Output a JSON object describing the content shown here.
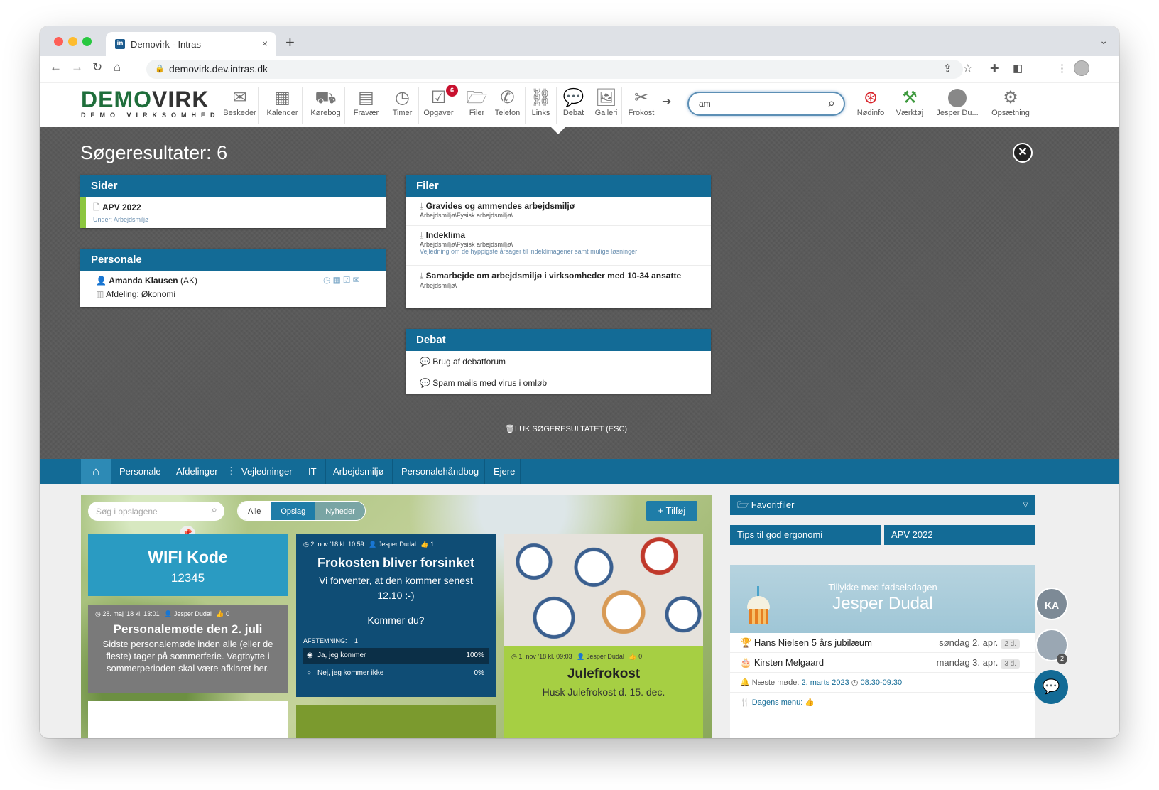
{
  "browser": {
    "tab_title": "Demovirk - Intras",
    "tab_favicon": "in",
    "url": "demovirk.dev.intras.dk",
    "new_tab": "+",
    "close_tab": "×"
  },
  "header": {
    "logo_main_a": "DEMO",
    "logo_main_b": "VIRK",
    "logo_sub": "DEMO VIRKSOMHED",
    "tools": [
      {
        "label": "Beskeder",
        "icon": "envelope-icon"
      },
      {
        "label": "Kalender",
        "icon": "calendar-icon"
      },
      {
        "label": "Kørebog",
        "icon": "car-icon"
      },
      {
        "label": "Fravær",
        "icon": "calendar-check-icon"
      },
      {
        "label": "Timer",
        "icon": "clock-icon"
      },
      {
        "label": "Opgaver",
        "icon": "checkbox-icon",
        "badge": "6"
      },
      {
        "label": "Filer",
        "icon": "folder-icon"
      },
      {
        "label": "Telefon",
        "icon": "phone-icon"
      },
      {
        "label": "Links",
        "icon": "link-icon"
      },
      {
        "label": "Debat",
        "icon": "chat-icon"
      },
      {
        "label": "Galleri",
        "icon": "gallery-icon"
      },
      {
        "label": "Frokost",
        "icon": "cutlery-icon"
      }
    ],
    "search_value": "am",
    "right_tools": [
      {
        "label": "Nødinfo",
        "icon": "lifebuoy-icon"
      },
      {
        "label": "Værktøj",
        "icon": "tools-icon"
      },
      {
        "label": "Jesper Du...",
        "icon": "user-avatar"
      },
      {
        "label": "Opsætning",
        "icon": "settings-icon"
      }
    ]
  },
  "results": {
    "title": "Søgeresultater: 6",
    "sider": {
      "heading": "Sider",
      "items": [
        {
          "title": "APV 2022",
          "sub": "Under: Arbejdsmiljø"
        }
      ]
    },
    "personale": {
      "heading": "Personale",
      "name": "Amanda Klausen",
      "initials": "(AK)",
      "dept": "Afdeling: Økonomi"
    },
    "filer": {
      "heading": "Filer",
      "items": [
        {
          "title": "Gravides og ammendes arbejdsmiljø",
          "path": "Arbejdsmiljø\\Fysisk arbejdsmiljø\\",
          "desc": ""
        },
        {
          "title": "Indeklima",
          "path": "Arbejdsmiljø\\Fysisk arbejdsmiljø\\",
          "desc": "Vejledning om de hyppigste årsager til indeklimagener samt mulige løsninger"
        },
        {
          "title": "Samarbejde om arbejdsmiljø i virksomheder med 10-34 ansatte",
          "path": "Arbejdsmiljø\\",
          "desc": ""
        }
      ]
    },
    "debat": {
      "heading": "Debat",
      "items": [
        {
          "title": "Brug af debatforum"
        },
        {
          "title": "Spam mails med virus i omløb"
        }
      ]
    },
    "close_label": "LUK SØGERESULTATET (ESC)"
  },
  "nav": {
    "items": [
      "Personale",
      "Afdelinger",
      "Vejledninger",
      "IT",
      "Arbejdsmiljø",
      "Personalehåndbog",
      "Ejere"
    ]
  },
  "board": {
    "search_placeholder": "Søg i opslagene",
    "filters": [
      "Alle",
      "Opslag",
      "Nyheder"
    ],
    "add_label": "+ Tilføj",
    "wifi": {
      "title": "WIFI Kode",
      "code": "12345"
    },
    "meeting": {
      "date": "28. maj '18 kl. 13:01",
      "author": "Jesper Dudal",
      "likes": "0",
      "title": "Personalemøde den 2. juli",
      "body": "Sidste personalemøde inden alle (eller de fleste) tager på sommerferie. Vagtbytte i sommerperioden skal være afklaret her."
    },
    "lunch": {
      "date": "2. nov '18 kl. 10:59",
      "author": "Jesper Dudal",
      "likes": "1",
      "title": "Frokosten bliver forsinket",
      "body": "Vi forventer, at den kommer senest 12.10 :-)",
      "question": "Kommer du?",
      "vote_label": "AFSTEMNING:",
      "vote_count": "1",
      "options": [
        {
          "label": "Ja, jeg kommer",
          "pct": "100%",
          "fraction": 1.0
        },
        {
          "label": "Nej, jeg kommer ikke",
          "pct": "0%",
          "fraction": 0.0
        }
      ]
    },
    "xmas": {
      "date": "1. nov '18 kl. 09:03",
      "author": "Jesper Dudal",
      "likes": "0",
      "title": "Julefrokost",
      "body": "Husk Julefrokost d. 15. dec."
    }
  },
  "sidebar": {
    "favorites_label": "Favoritfiler",
    "links": [
      "Tips til god ergonomi",
      "APV 2022"
    ],
    "bday_greeting": "Tillykke med fødselsdagen",
    "bday_name": "Jesper Dudal",
    "events": [
      {
        "title": "Hans Nielsen 5 års jubilæum",
        "date": "søndag 2. apr.",
        "tag": "2 d."
      },
      {
        "title": "Kirsten Melgaard",
        "date": "mandag 3. apr.",
        "tag": "3 d."
      }
    ],
    "meeting_label": "Næste møde:",
    "meeting_date": "2. marts 2023",
    "meeting_time": "08:30-09:30",
    "menu_label": "Dagens menu:",
    "user_initials": "KA",
    "chat_badge": "2"
  }
}
